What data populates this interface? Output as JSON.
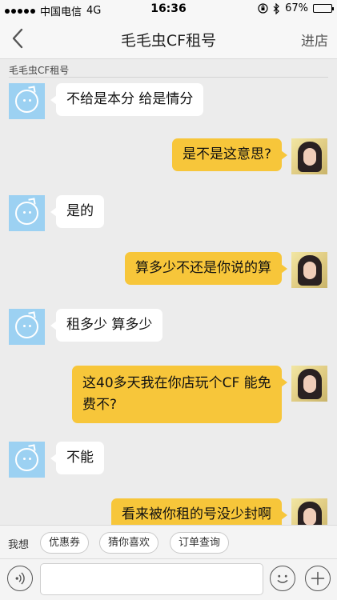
{
  "status_bar": {
    "carrier": "中国电信",
    "network": "4G",
    "time": "16:36",
    "battery": "67%",
    "battery_level": 0.67
  },
  "nav": {
    "title": "毛毛虫CF租号",
    "action": "进店"
  },
  "chat": {
    "shop_label": "毛毛虫CF租号",
    "messages": [
      {
        "from": "shop",
        "text": "不给是本分  给是情分"
      },
      {
        "from": "user",
        "text": "是不是这意思?"
      },
      {
        "from": "shop",
        "text": "是的"
      },
      {
        "from": "user",
        "text": "算多少不还是你说的算"
      },
      {
        "from": "shop",
        "text": "租多少  算多少"
      },
      {
        "from": "user",
        "text": "这40多天我在你店玩个CF 能免费不?"
      },
      {
        "from": "shop",
        "text": "不能"
      },
      {
        "from": "user",
        "text": "看来被你租的号没少封啊"
      }
    ]
  },
  "quick_actions": {
    "label": "我想",
    "items": [
      "优惠券",
      "猜你喜欢",
      "订单查询"
    ]
  },
  "input": {
    "value": ""
  },
  "colors": {
    "user_bubble": "#f7c63a",
    "shop_bubble": "#ffffff",
    "chat_bg": "#ececec",
    "shop_avatar": "#9cd1f2"
  }
}
